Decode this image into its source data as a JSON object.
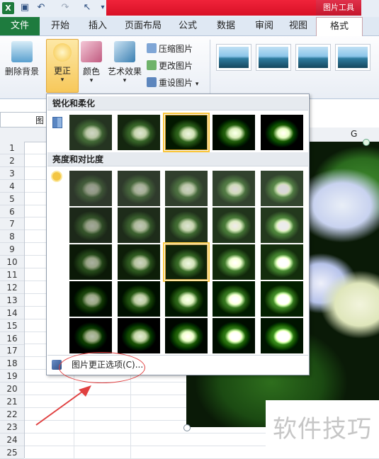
{
  "app": "Excel",
  "title_bar": {
    "context_group": "图片工具",
    "qat_icons": [
      "save-icon",
      "undo-icon",
      "redo-icon",
      "pointer-icon",
      "customize-icon"
    ]
  },
  "tabs": {
    "file": "文件",
    "items": [
      "开始",
      "插入",
      "页面布局",
      "公式",
      "数据",
      "审阅",
      "视图"
    ],
    "active": "格式"
  },
  "ribbon": {
    "remove_background": "删除背景",
    "corrections": "更正",
    "color": "颜色",
    "artistic_effects": "艺术效果",
    "compress": "压缩图片",
    "change": "更改图片",
    "reset": "重设图片"
  },
  "gallery": {
    "section_sharpen": "锐化和柔化",
    "section_brightness": "亮度和对比度",
    "options_label": "图片更正选项(C)...",
    "sharpen_selected_index": 2,
    "brightness_selected": {
      "row": 2,
      "col": 2
    }
  },
  "namebox": {
    "value": "图"
  },
  "sheet": {
    "column_header_visible": "G",
    "rows": [
      "1",
      "2",
      "3",
      "4",
      "5",
      "6",
      "7",
      "8",
      "9",
      "10",
      "11",
      "12",
      "13",
      "14",
      "15",
      "16",
      "17",
      "18",
      "19",
      "20",
      "21",
      "22",
      "23",
      "24",
      "25"
    ]
  },
  "watermark": "软件技巧",
  "colors": {
    "file_tab": "#1e7b3e",
    "context_band": "#d81025",
    "annotation": "#e04040",
    "selected_outline": "#f0c040"
  }
}
